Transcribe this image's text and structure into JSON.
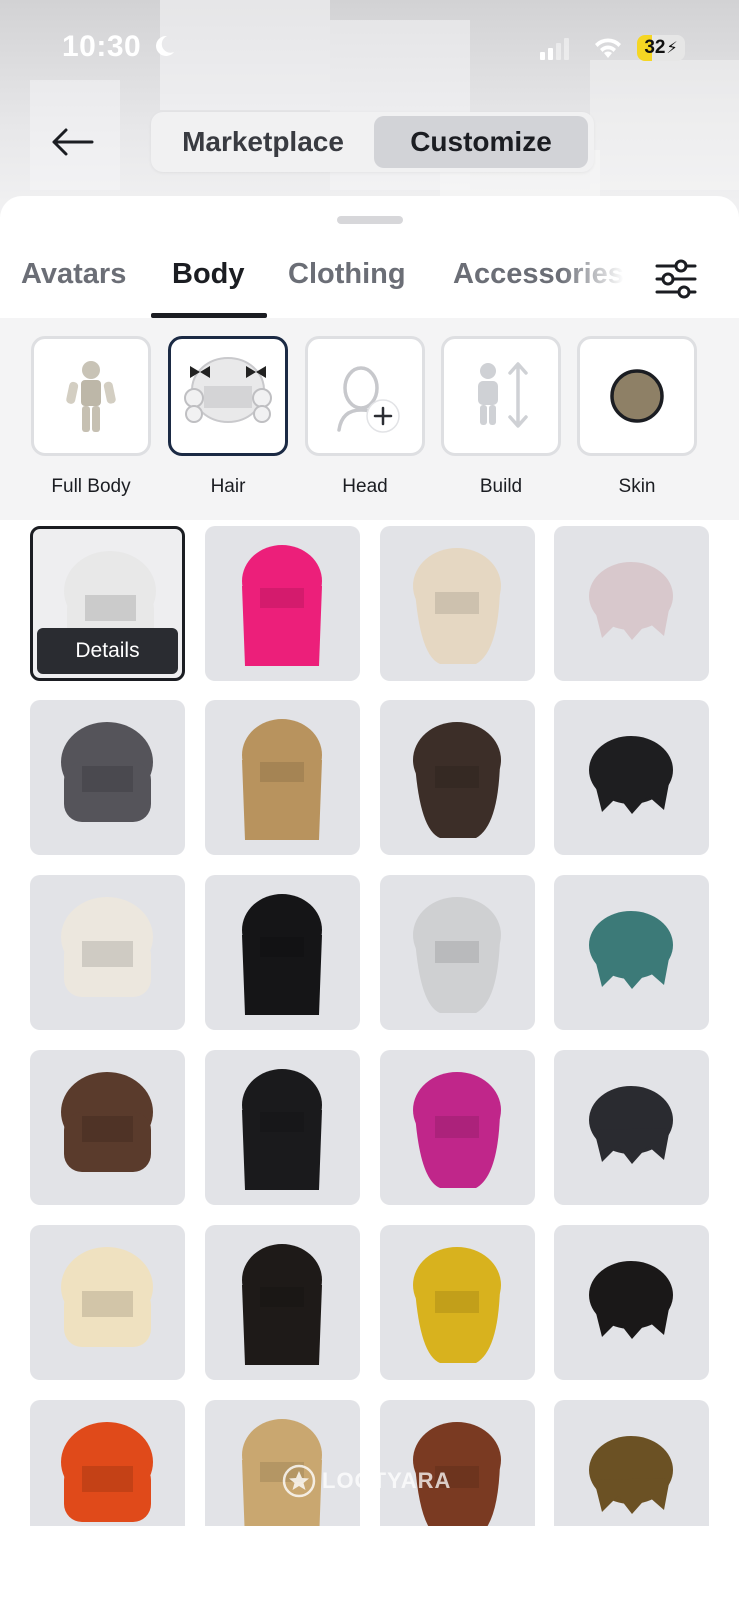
{
  "status_bar": {
    "time": "10:30",
    "battery": "32",
    "battery_level": 0.32,
    "battery_color": "#f5d623"
  },
  "header": {
    "back_icon": "arrow-left-icon",
    "segments": [
      {
        "label": "Marketplace",
        "active": false
      },
      {
        "label": "Customize",
        "active": true
      }
    ]
  },
  "tabs": {
    "items": [
      {
        "label": "Avatars",
        "active": false
      },
      {
        "label": "Body",
        "active": true
      },
      {
        "label": "Clothing",
        "active": false
      },
      {
        "label": "Accessories",
        "active": false
      }
    ],
    "filter_icon": "sliders-icon"
  },
  "body_categories": [
    {
      "label": "Full Body",
      "icon": "full-body-icon",
      "selected": false
    },
    {
      "label": "Hair",
      "icon": "hair-icon",
      "selected": true
    },
    {
      "label": "Head",
      "icon": "head-add-icon",
      "selected": false
    },
    {
      "label": "Build",
      "icon": "build-icon",
      "selected": false
    },
    {
      "label": "Skin",
      "icon": "skin-swatch-icon",
      "selected": false,
      "color": "#8e8066"
    }
  ],
  "hair_items": {
    "details_label": "Details",
    "items": [
      {
        "name": "white-curly-bow-hair",
        "color": "#e8e8e8",
        "selected": true
      },
      {
        "name": "pink-straight-hair",
        "color": "#ec1f7a"
      },
      {
        "name": "blonde-wavy-hair",
        "color": "#e5d7c2"
      },
      {
        "name": "silver-pigtails-hair",
        "color": "#d8c8cc"
      },
      {
        "name": "grey-pigtails-hair",
        "color": "#55545a"
      },
      {
        "name": "spiky-blonde-hair",
        "color": "#b8935e"
      },
      {
        "name": "brown-wavy-hair",
        "color": "#3c2e28"
      },
      {
        "name": "black-short-hair",
        "color": "#1e1e20"
      },
      {
        "name": "white-ringlets-hair",
        "color": "#ece7de"
      },
      {
        "name": "black-bob-hair",
        "color": "#151517"
      },
      {
        "name": "silver-bob-hair",
        "color": "#cfd0d2"
      },
      {
        "name": "teal-layered-hair",
        "color": "#3c7a78"
      },
      {
        "name": "brown-ponytail-hair",
        "color": "#5a3b2c"
      },
      {
        "name": "black-bow-hair",
        "color": "#1a1a1c"
      },
      {
        "name": "magenta-cat-hair",
        "color": "#c0268a"
      },
      {
        "name": "black-messy-hair",
        "color": "#2a2b30"
      },
      {
        "name": "blonde-swept-hair",
        "color": "#efe1c0"
      },
      {
        "name": "black-sunglasses-hair",
        "color": "#1e1a18"
      },
      {
        "name": "yellow-spiky-hair",
        "color": "#d8b21e"
      },
      {
        "name": "beanie-black-hair",
        "color": "#1a1818"
      },
      {
        "name": "orange-braided-hair",
        "color": "#e04a1a"
      },
      {
        "name": "blonde-long-hair",
        "color": "#c9a770"
      },
      {
        "name": "auburn-ponytail-hair",
        "color": "#7a3a22"
      },
      {
        "name": "brown-bun-hair",
        "color": "#6b5124"
      }
    ]
  },
  "watermark": "LOOTYARA"
}
